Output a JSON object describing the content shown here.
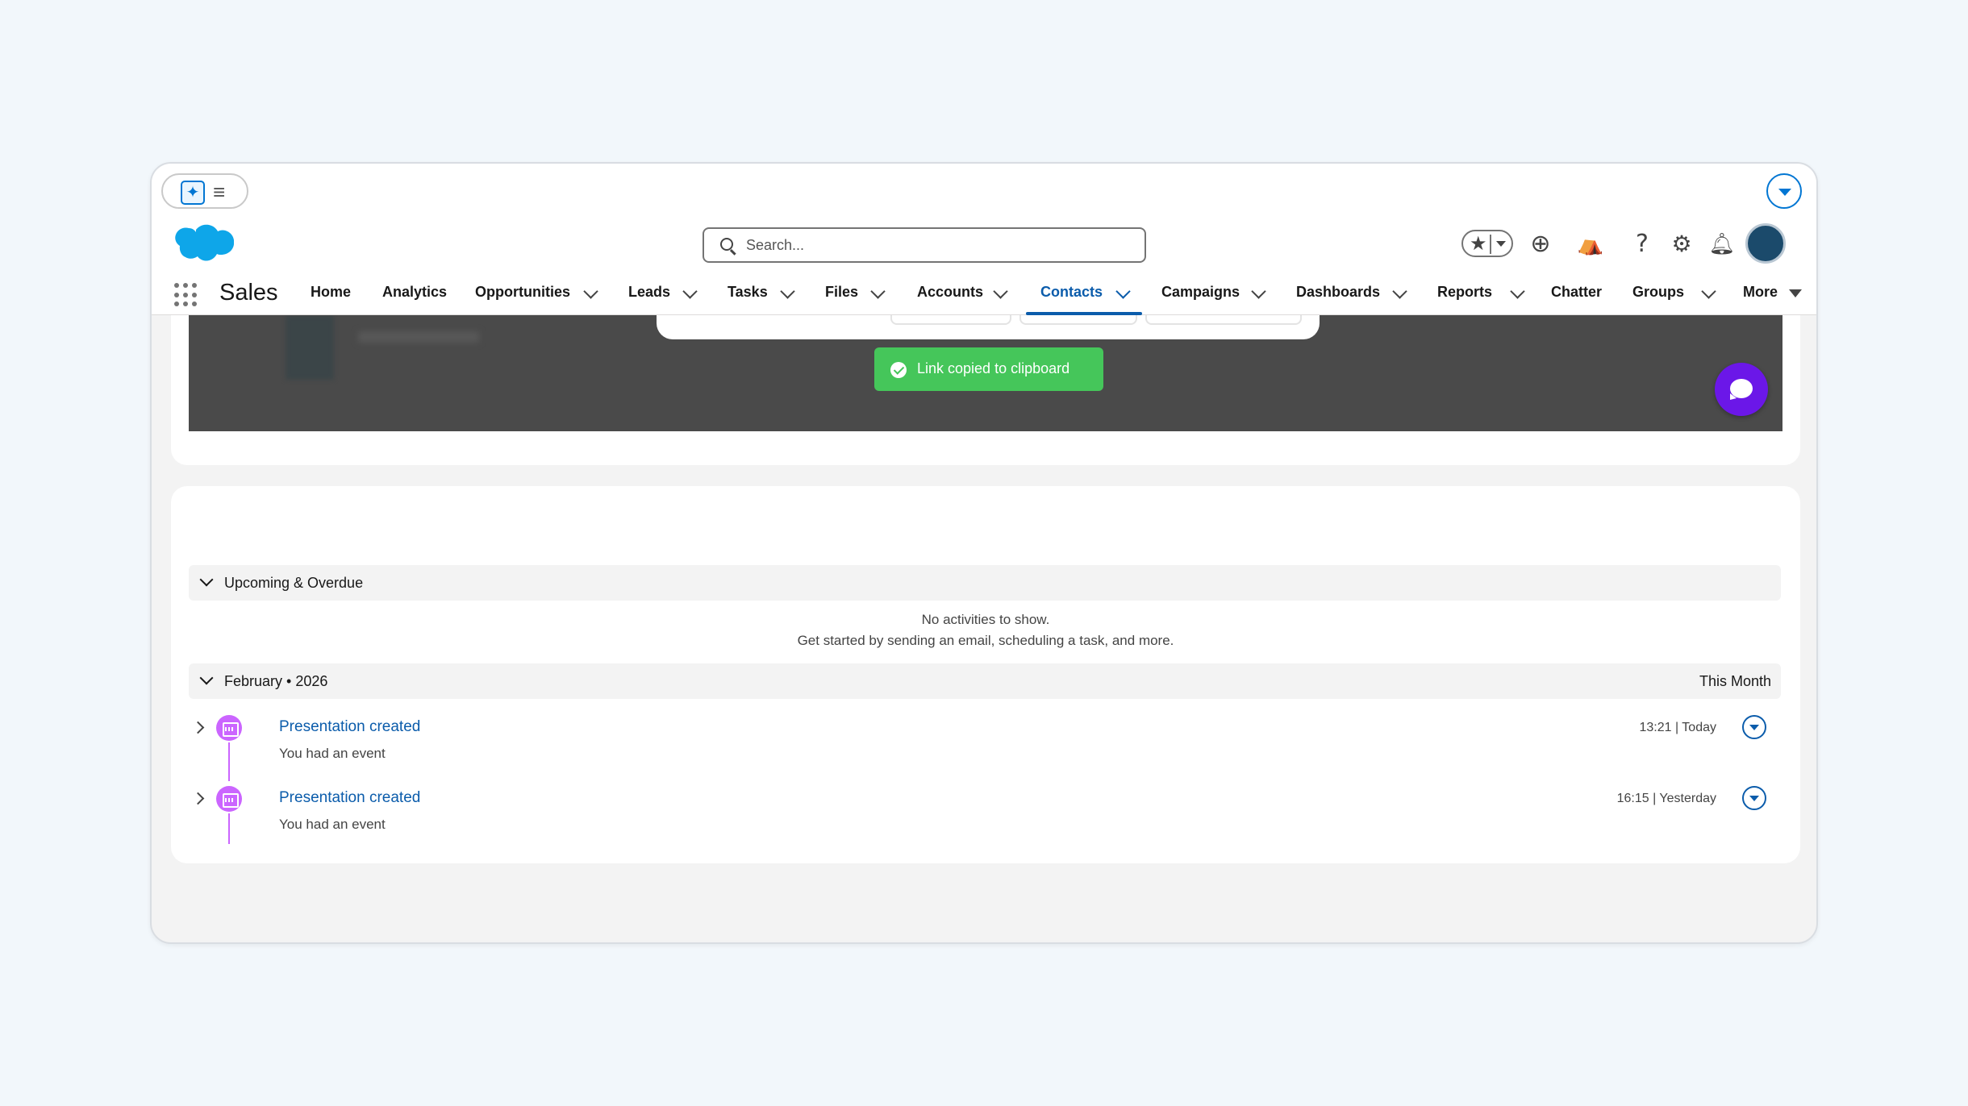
{
  "header": {
    "search_placeholder": "Search...",
    "app_name": "Sales"
  },
  "nav": {
    "items": [
      {
        "label": "Home"
      },
      {
        "label": "Analytics"
      },
      {
        "label": "Opportunities"
      },
      {
        "label": "Leads"
      },
      {
        "label": "Tasks"
      },
      {
        "label": "Files"
      },
      {
        "label": "Accounts"
      },
      {
        "label": "Contacts"
      },
      {
        "label": "Campaigns"
      },
      {
        "label": "Dashboards"
      },
      {
        "label": "Reports"
      },
      {
        "label": "Chatter"
      },
      {
        "label": "Groups"
      },
      {
        "label": "More"
      }
    ],
    "active": "Contacts"
  },
  "toast": {
    "message": "Link copied to clipboard"
  },
  "activity": {
    "upcoming_label": "Upcoming & Overdue",
    "empty_line1": "No activities to show.",
    "empty_line2": "Get started by sending an email, scheduling a task, and more.",
    "month_label": "February • 2026",
    "month_right": "This Month",
    "items": [
      {
        "title": "Presentation created",
        "subtitle": "You had an event",
        "time": "13:21 | Today"
      },
      {
        "title": "Presentation created",
        "subtitle": "You had an event",
        "time": "16:15 | Yesterday"
      }
    ]
  },
  "colors": {
    "brand": "#0176d3",
    "active_nav": "#0b5cab",
    "toast": "#45c65a",
    "event_icon": "#cb65ff",
    "chat_button": "#6b17e8"
  }
}
